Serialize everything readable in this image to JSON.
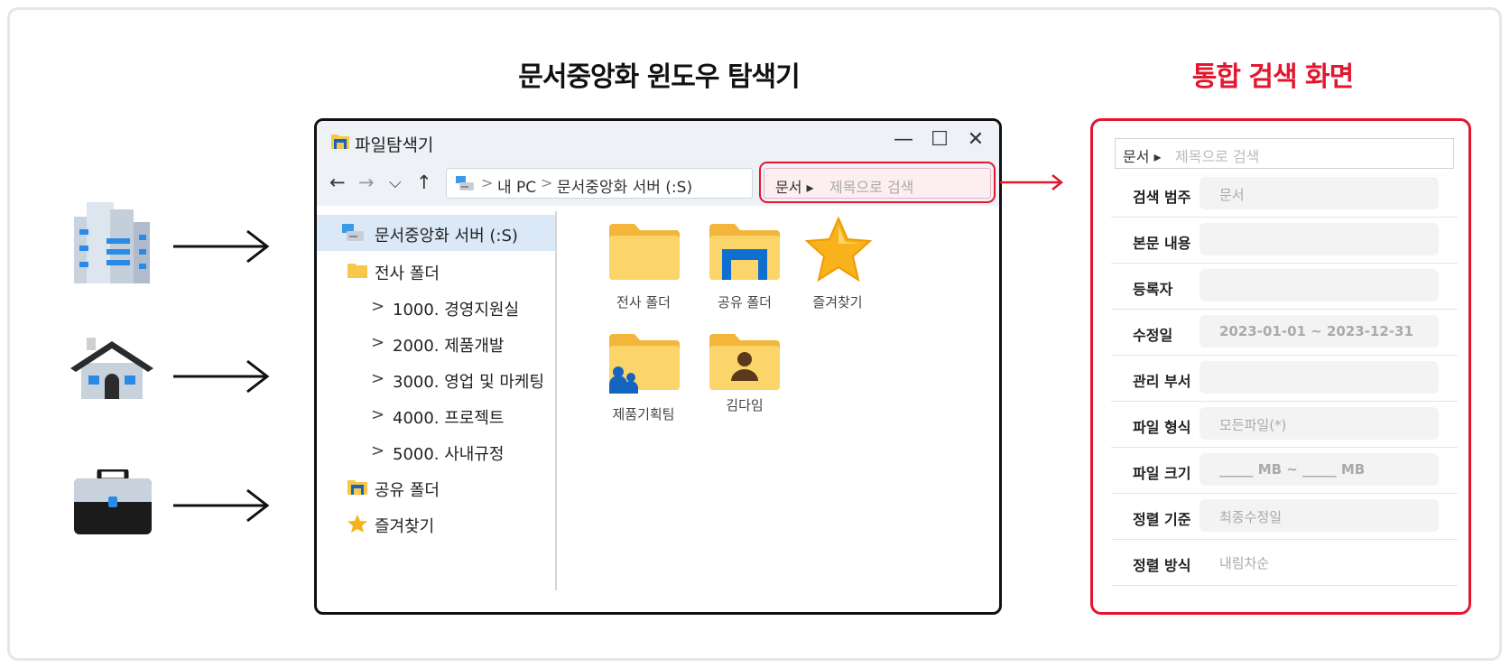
{
  "titles": {
    "left": "문서중앙화 윈도우 탐색기",
    "right": "통합 검색 화면"
  },
  "icons": [
    "building-icon",
    "house-icon",
    "briefcase-icon"
  ],
  "explorer": {
    "window_title": "파일탐색기",
    "controls": {
      "minimize": "—",
      "maximize": "☐",
      "close": "✕"
    },
    "nav": {
      "back": "←",
      "forward": "→",
      "down": "⌵",
      "up": "↑"
    },
    "breadcrumb": [
      "내 PC",
      "문서중앙화 서버 (:S)"
    ],
    "breadcrumb_sep": ">",
    "search": {
      "prefix": "문서 ▸",
      "placeholder": "제목으로 검색"
    },
    "sidebar": [
      {
        "label": "문서중앙화 서버 (:S)",
        "icon": "server-drive-icon",
        "active": true
      },
      {
        "label": "전사 폴더",
        "icon": "folder-icon"
      },
      {
        "label": "1000. 경영지원실",
        "chevron": ">"
      },
      {
        "label": "2000. 제품개발",
        "chevron": ">"
      },
      {
        "label": "3000. 영업 및 마케팅",
        "chevron": ">"
      },
      {
        "label": "4000. 프로젝트",
        "chevron": ">"
      },
      {
        "label": "5000. 사내규정",
        "chevron": ">"
      },
      {
        "label": "공유 폴더",
        "icon": "shared-folder-icon"
      },
      {
        "label": "즐겨찾기",
        "icon": "star-icon"
      }
    ],
    "content": [
      {
        "label": "전사 폴더",
        "icon": "folder-icon"
      },
      {
        "label": "공유 폴더",
        "icon": "shared-folder-icon"
      },
      {
        "label": "즐겨찾기",
        "icon": "star-icon"
      },
      {
        "label": "제품기획팀",
        "icon": "team-folder-icon"
      },
      {
        "label": "김다임",
        "icon": "user-folder-icon"
      }
    ]
  },
  "panel": {
    "search": {
      "prefix": "문서 ▸",
      "placeholder": "제목으로 검색"
    },
    "rows": [
      {
        "label": "검색 범주",
        "value": "문서"
      },
      {
        "label": "본문 내용",
        "value": ""
      },
      {
        "label": "등록자",
        "value": ""
      },
      {
        "label": "수정일",
        "value": "2023-01-01 ~ 2023-12-31"
      },
      {
        "label": "관리 부서",
        "value": ""
      },
      {
        "label": "파일 형식",
        "value": "모든파일(*)"
      },
      {
        "label": "파일 크기",
        "value": "_____ MB ~ _____ MB"
      },
      {
        "label": "정렬 기준",
        "value": "최종수정일"
      },
      {
        "label": "정렬 방식",
        "value": "내림차순"
      }
    ]
  },
  "colors": {
    "accent": "#e2172f",
    "selection": "#dbe8f7",
    "folder": "#f7c74a"
  }
}
